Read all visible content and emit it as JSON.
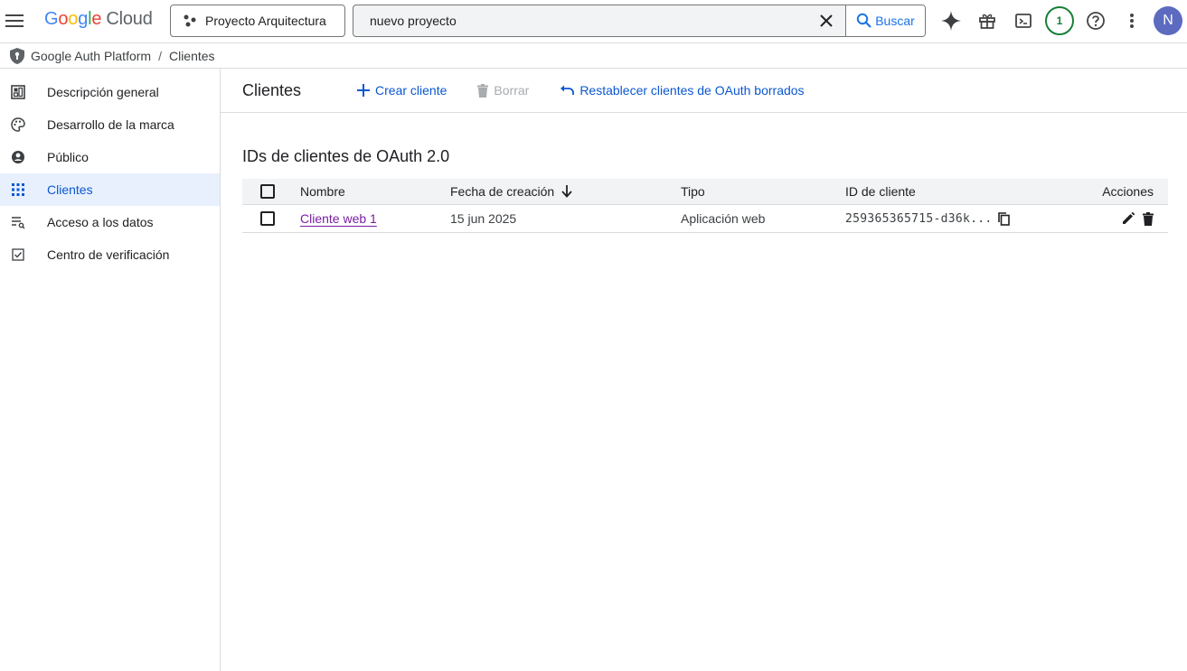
{
  "header": {
    "logo": {
      "letters": [
        "G",
        "o",
        "o",
        "g",
        "l",
        "e"
      ],
      "product": "Cloud"
    },
    "project_selector": {
      "label": "Proyecto Arquitectura",
      "icon": "project-tree-icon"
    },
    "search": {
      "value": "nuevo proyecto",
      "button_label": "Buscar"
    },
    "notifications_count": "1",
    "avatar_initial": "N",
    "icons": [
      "menu-icon",
      "gemini-sparkle-icon",
      "gift-icon",
      "cloud-shell-icon",
      "help-icon",
      "more-vert-icon"
    ]
  },
  "breadcrumb": {
    "items": [
      "Google Auth Platform",
      "Clientes"
    ],
    "separator": "/"
  },
  "sidebar": {
    "items": [
      {
        "label": "Descripción general",
        "icon": "dashboard-icon",
        "active": false
      },
      {
        "label": "Desarrollo de la marca",
        "icon": "palette-icon",
        "active": false
      },
      {
        "label": "Público",
        "icon": "person-icon",
        "active": false
      },
      {
        "label": "Clientes",
        "icon": "apps-grid-icon",
        "active": true
      },
      {
        "label": "Acceso a los datos",
        "icon": "data-access-icon",
        "active": false
      },
      {
        "label": "Centro de verificación",
        "icon": "verified-checkbox-icon",
        "active": false
      }
    ]
  },
  "main": {
    "title": "Clientes",
    "toolbar": {
      "create_label": "Crear cliente",
      "delete_label": "Borrar",
      "restore_label": "Restablecer clientes de OAuth borrados"
    },
    "section_title": "IDs de clientes de OAuth 2.0",
    "table": {
      "headers": {
        "name": "Nombre",
        "date": "Fecha de creación",
        "type": "Tipo",
        "client_id": "ID de cliente",
        "actions": "Acciones"
      },
      "sort": {
        "column": "date",
        "direction": "descending"
      },
      "rows": [
        {
          "name": "Cliente web 1",
          "date": "15 jun 2025",
          "type": "Aplicación web",
          "client_id": "259365365715-d36k..."
        }
      ]
    }
  },
  "colors": {
    "accent": "#0b57d0",
    "active_nav_bg": "#e8f0fe",
    "visited_link": "#7b1fa2",
    "notification_ring": "#188038",
    "avatar_bg": "#5c6bc0"
  }
}
